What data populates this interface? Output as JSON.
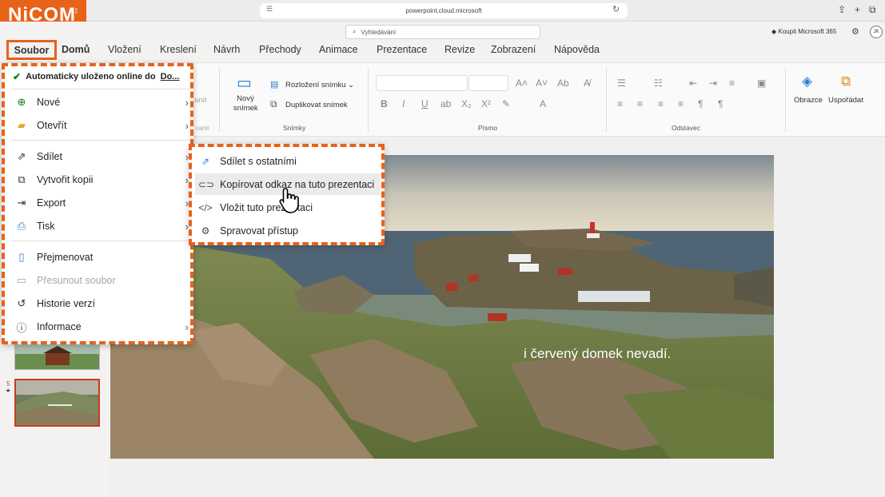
{
  "browser": {
    "url": "powerpoint.cloud.microsoft"
  },
  "logo": {
    "text": "NiCOM",
    "sub": "a.s."
  },
  "titlebar": {
    "search_placeholder": "Vyhledávání",
    "buy_label": "Koupit Microsoft 365",
    "avatar": "JK"
  },
  "menu": {
    "tabs": [
      "Soubor",
      "Domů",
      "Vložení",
      "Kreslení",
      "Návrh",
      "Přechody",
      "Animace",
      "Prezentace",
      "Revize",
      "Zobrazení",
      "Nápověda"
    ]
  },
  "ribbon": {
    "new_slide": "Nový snímek",
    "layout": "Rozložení snímku",
    "duplicate": "Duplikovat snímek",
    "group_slides": "Snímky",
    "group_font": "Písmo",
    "group_paragraph": "Odstavec",
    "shapes": "Obrazce",
    "arrange": "Uspořádat",
    "clipboard_partial": "ranit"
  },
  "file_menu": {
    "autosave": "Automaticky uloženo online do",
    "autosave_link": "Do...",
    "items": [
      "Nové",
      "Otevřít",
      "Sdílet",
      "Vytvořit kopii",
      "Export",
      "Tisk",
      "Přejmenovat",
      "Přesunout soubor",
      "Historie verzí",
      "Informace"
    ]
  },
  "share_submenu": {
    "items": [
      "Sdílet s ostatními",
      "Kopírovat odkaz na tuto prezentaci",
      "Vložit tuto prezentaci",
      "Spravovat přístup"
    ]
  },
  "slide": {
    "caption": "i červený domek nevadí."
  },
  "thumbnails": {
    "current_number": "5",
    "star": "★"
  }
}
